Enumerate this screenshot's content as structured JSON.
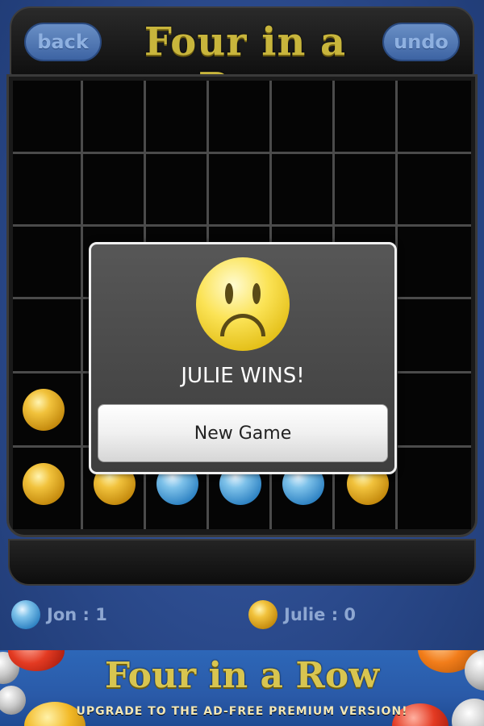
{
  "header": {
    "back_label": "back",
    "title": "Four in a Row",
    "undo_label": "undo"
  },
  "board": {
    "columns": 7,
    "rows": 6,
    "colors": {
      "yellow": "#f1c23c",
      "blue": "#2f83c3"
    }
  },
  "dialog": {
    "icon": "sad-face-icon",
    "message": "JULIE WINS!",
    "new_game_label": "New Game"
  },
  "scores": [
    {
      "player": "Jon",
      "color": "blue",
      "text": "Jon : 1"
    },
    {
      "player": "Julie",
      "color": "yellow",
      "text": "Julie : 0"
    }
  ],
  "banner": {
    "title": "Four in a Row",
    "subtitle": "UPGRADE TO THE AD-FREE PREMIUM VERSION!"
  }
}
